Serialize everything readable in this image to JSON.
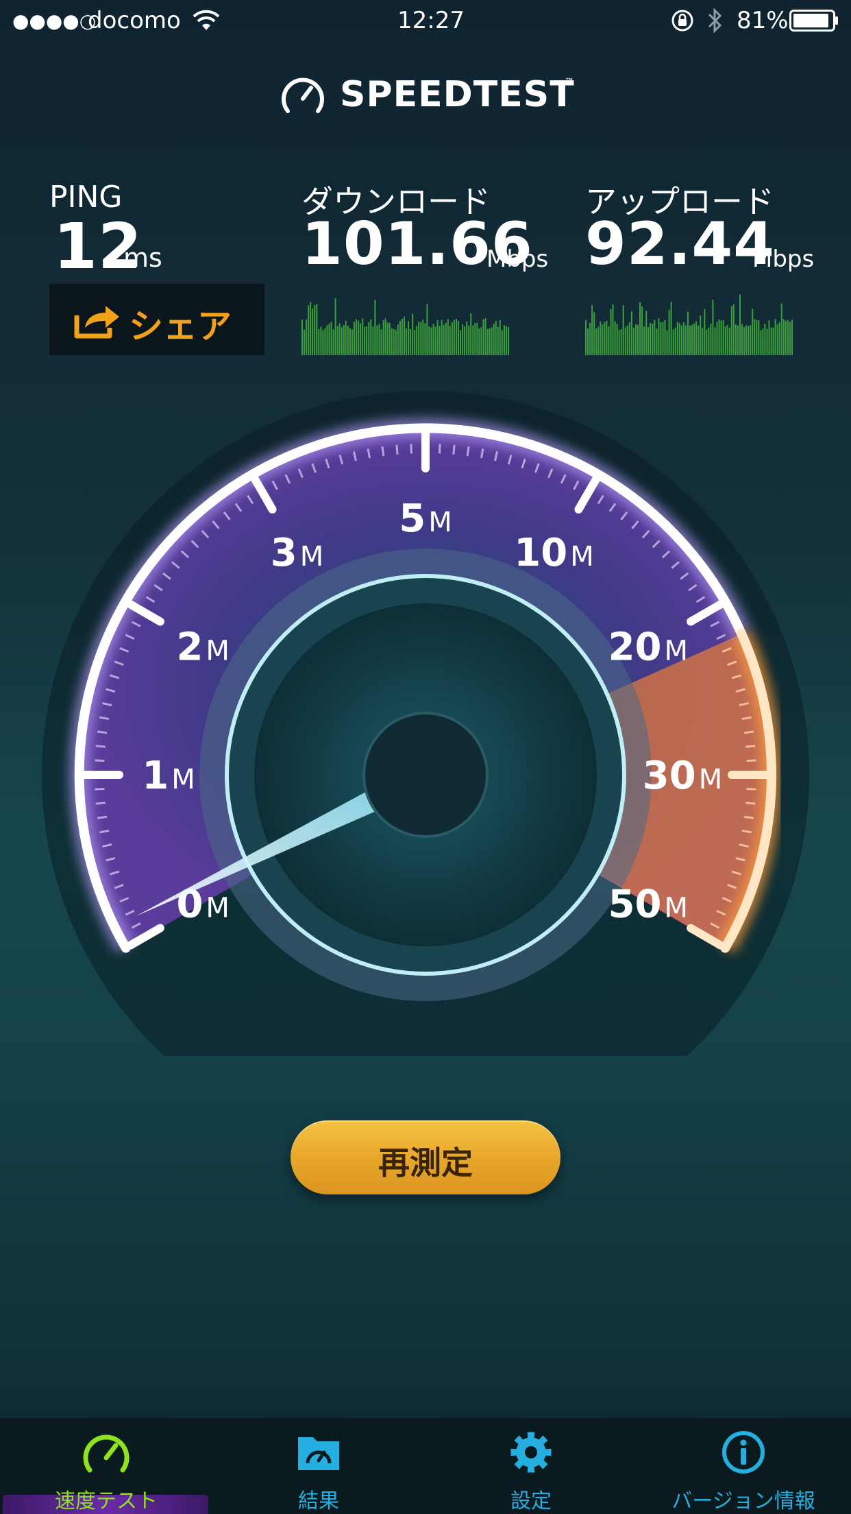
{
  "status_bar": {
    "signal": "●●●●○",
    "carrier": "docomo",
    "time": "12:27",
    "battery": "81%"
  },
  "header": {
    "title": "SPEEDTEST",
    "trademark": "™"
  },
  "ping": {
    "label": "PING",
    "value": "12",
    "unit": "ms"
  },
  "download": {
    "label": "ダウンロード",
    "value": "101.66",
    "unit": "Mbps"
  },
  "upload": {
    "label": "アップロード",
    "value": "92.44",
    "unit": "Mbps"
  },
  "share": {
    "label": "シェア"
  },
  "gauge": {
    "ticks": [
      {
        "num": "0",
        "unit": "M"
      },
      {
        "num": "1",
        "unit": "M"
      },
      {
        "num": "2",
        "unit": "M"
      },
      {
        "num": "3",
        "unit": "M"
      },
      {
        "num": "5",
        "unit": "M"
      },
      {
        "num": "10",
        "unit": "M"
      },
      {
        "num": "20",
        "unit": "M"
      },
      {
        "num": "30",
        "unit": "M"
      },
      {
        "num": "50",
        "unit": "M"
      }
    ]
  },
  "retest": {
    "label": "再測定"
  },
  "tabs": [
    {
      "label": "速度テスト",
      "icon": "speedometer-icon",
      "active": true
    },
    {
      "label": "結果",
      "icon": "folder-icon",
      "active": false
    },
    {
      "label": "設定",
      "icon": "gear-icon",
      "active": false
    },
    {
      "label": "バージョン情報",
      "icon": "info-icon",
      "active": false
    }
  ],
  "colors": {
    "accent": "#f2a21a",
    "tab_active": "#8ee31c",
    "tab_inactive": "#25aee0",
    "gauge_purple": "#5a3c9a",
    "gauge_orange": "#f08a3a"
  }
}
